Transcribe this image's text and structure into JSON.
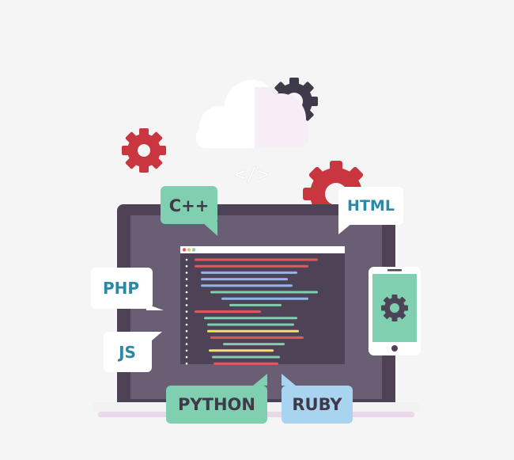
{
  "code_tag": "</>",
  "bubbles": {
    "cpp": "C++",
    "html": "HTML",
    "php": "PHP",
    "js": "JS",
    "python": "PYTHON",
    "ruby": "RUBY"
  },
  "colors": {
    "background": "#f5f5f5",
    "laptop_frame": "#4e4356",
    "laptop_screen": "#695e73",
    "code_panel": "#4e4356",
    "laptop_base": "#f2f2f2",
    "gear_red": "#c9363f",
    "gear_dark": "#3f3a49",
    "cloud_white": "#ffffff",
    "cloud_pink": "#f7edf7",
    "teal_text": "#2a8aa6",
    "dark_text": "#3f3a49",
    "green_bubble": "#7fcfb0",
    "blue_bubble": "#a8d4ef",
    "phone_screen": "#7fcfb0"
  },
  "icons": [
    "gear-icon",
    "cloud-icon",
    "code-tag-icon",
    "window-dots-icon",
    "smartphone-icon"
  ]
}
